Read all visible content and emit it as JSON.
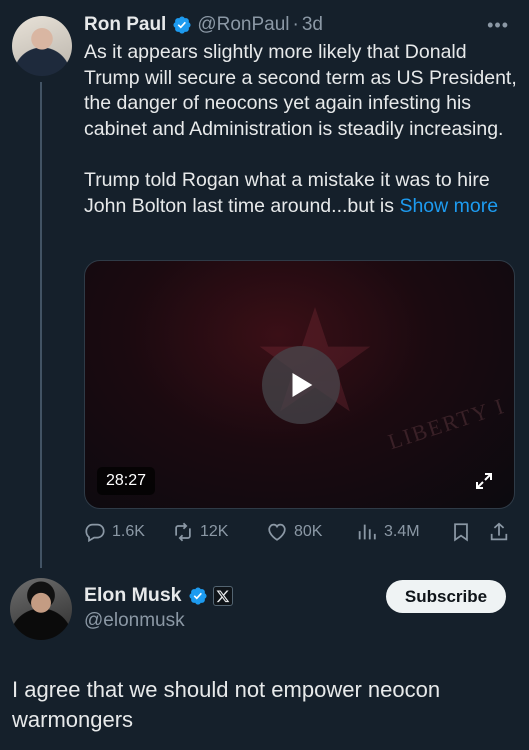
{
  "tweet": {
    "author_name": "Ron Paul",
    "handle": "@RonPaul",
    "separator": "·",
    "age": "3d",
    "more_icon": "more-icon",
    "text_1": "As it appears slightly more likely that Donald Trump will secure a second term as US President, the danger of neocons yet again infesting his cabinet and Administration is steadily increasing.",
    "text_2": "Trump told Rogan what a mistake it was to hire John Bolton last time around...but is ",
    "show_more": "Show more",
    "video": {
      "duration": "28:27",
      "watermark": "LIBERTY I"
    },
    "stats": {
      "replies": "1.6K",
      "reposts": "12K",
      "likes": "80K",
      "views": "3.4M"
    }
  },
  "reply": {
    "author_name": "Elon Musk",
    "handle": "@elonmusk",
    "subscribe_label": "Subscribe",
    "text": "I agree that we should not empower neocon warmongers"
  },
  "colors": {
    "background": "#15202b",
    "accent": "#1d9bf0",
    "muted": "#8b98a5",
    "text": "#e7e9ea"
  }
}
